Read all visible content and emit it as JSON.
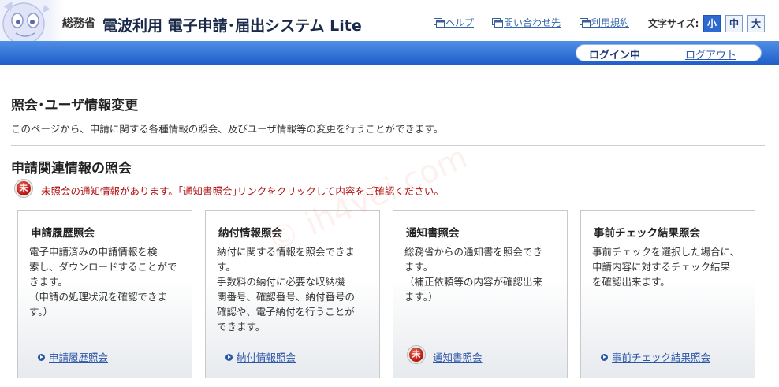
{
  "header": {
    "ministry": "総務省",
    "system_title": "電波利用 電子申請･届出システム Lite",
    "links": {
      "help": "ヘルプ",
      "contact": "問い合わせ先",
      "terms": "利用規約"
    },
    "font_size": {
      "label": "文字サイズ:",
      "small": "小",
      "medium": "中",
      "large": "大",
      "selected": "小"
    }
  },
  "login_bar": {
    "status": "ログイン中",
    "logout": "ログアウト"
  },
  "page": {
    "title": "照会･ユーザ情報変更",
    "description": "このページから、申請に関する各種情報の照会、及びユーザ情報等の変更を行うことができます。"
  },
  "section": {
    "title": "申請関連情報の照会",
    "notice_badge": "未",
    "notice_text": "未照会の通知情報があります。｢通知書照会｣リンクをクリックして内容をご確認ください。"
  },
  "cards": [
    {
      "title": "申請履歴照会",
      "description": "電子申請済みの申請情報を検\n索し、ダウンロードすることがで\nきます。\n（申請の処理状況を確認できま\nす。）",
      "link": "申請履歴照会"
    },
    {
      "title": "納付情報照会",
      "description": "納付に関する情報を照会できま\nす。\n手数料の納付に必要な収納機\n関番号、確認番号、納付番号の\n確認や、電子納付を行うことが\nできます。",
      "link": "納付情報照会"
    },
    {
      "title": "通知書照会",
      "description": "総務省からの通知書を照会でき\nます。\n（補正依頼等の内容が確認出来\nます。）",
      "link": "通知書照会",
      "link_badge": "未"
    },
    {
      "title": "事前チェック結果照会",
      "description": "事前チェックを選択した場合に、\n申請内容に対するチェック結果\nを確認出来ます。",
      "link": "事前チェック結果照会"
    }
  ],
  "watermark": "© ih4vei.com",
  "colors": {
    "accent_blue": "#1f5fc9",
    "notice_red": "#b01010",
    "link_blue": "#2a56a8"
  }
}
